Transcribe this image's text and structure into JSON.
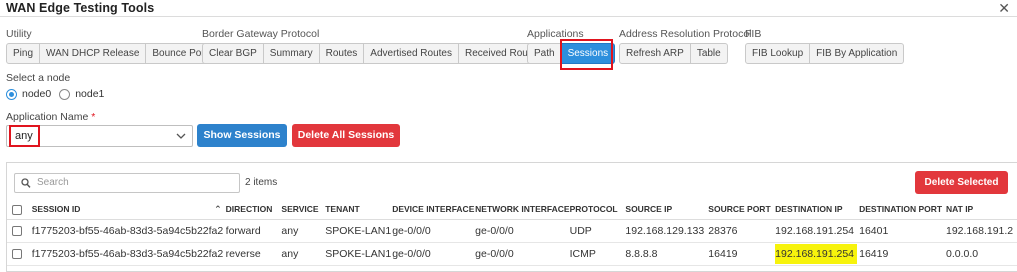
{
  "window": {
    "title": "WAN Edge Testing Tools"
  },
  "groups": [
    {
      "label": "Utility",
      "buttons": [
        "Ping",
        "WAN DHCP Release",
        "Bounce Port"
      ]
    },
    {
      "label": "Border Gateway Protocol",
      "buttons": [
        "Clear BGP",
        "Summary",
        "Routes",
        "Advertised Routes",
        "Received Routes"
      ]
    },
    {
      "label": "Applications",
      "buttons": [
        "Path",
        "Sessions"
      ]
    },
    {
      "label": "Address Resolution Protocol",
      "buttons": [
        "Refresh ARP",
        "Table"
      ]
    },
    {
      "label": "FIB",
      "buttons": [
        "FIB Lookup",
        "FIB By Application"
      ]
    }
  ],
  "active_button": "Sessions",
  "node": {
    "label": "Select a node",
    "options": [
      "node0",
      "node1"
    ],
    "selected": "node0"
  },
  "application": {
    "label": "Application Name",
    "required_mark": "*",
    "value": "any"
  },
  "actions": {
    "show_sessions": "Show Sessions",
    "delete_all": "Delete All Sessions"
  },
  "table_panel": {
    "search_placeholder": "Search",
    "item_count": "2 items",
    "delete_selected": "Delete Selected",
    "columns": [
      "SESSION ID",
      "DIRECTION",
      "SERVICE",
      "TENANT",
      "DEVICE INTERFACE",
      "NETWORK INTERFACE",
      "PROTOCOL",
      "SOURCE IP",
      "SOURCE PORT",
      "DESTINATION IP",
      "DESTINATION PORT",
      "NAT IP"
    ],
    "rows": [
      [
        "f1775203-bf55-46ab-83d3-5a94c5b22fa2",
        "forward",
        "any",
        "SPOKE-LAN1",
        "ge-0/0/0",
        "ge-0/0/0",
        "UDP",
        "192.168.129.133",
        "28376",
        "192.168.191.254",
        "16401",
        "192.168.191.2"
      ],
      [
        "f1775203-bf55-46ab-83d3-5a94c5b22fa2",
        "reverse",
        "any",
        "SPOKE-LAN1",
        "ge-0/0/0",
        "ge-0/0/0",
        "ICMP",
        "8.8.8.8",
        "16419",
        "192.168.191.254",
        "16419",
        "0.0.0.0"
      ]
    ]
  },
  "colors": {
    "accent_blue": "#2d82cc",
    "danger_red": "#e2373c",
    "annotation_red": "#e0141e",
    "highlight_yellow": "#f7f30c"
  }
}
